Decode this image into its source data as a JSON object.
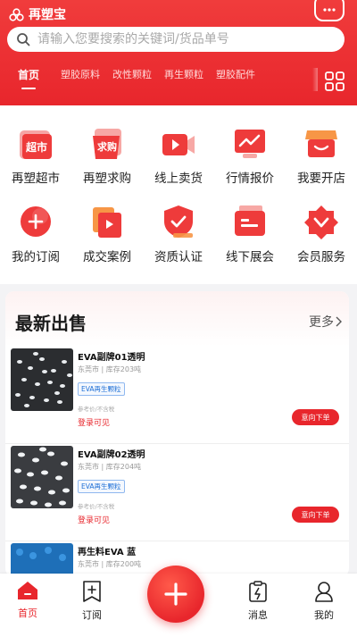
{
  "app": {
    "name": "再塑宝"
  },
  "search": {
    "placeholder": "请输入您要搜索的关键词/货品单号"
  },
  "tabs": [
    {
      "label": "首页",
      "active": true
    },
    {
      "label": "塑胶原料"
    },
    {
      "label": "改性颗粒"
    },
    {
      "label": "再生颗粒"
    },
    {
      "label": "塑胶配件"
    }
  ],
  "categories": [
    {
      "label": "再塑超市",
      "icon": "supermarket-icon",
      "badge": "超市"
    },
    {
      "label": "再塑求购",
      "icon": "purchase-icon",
      "badge": "求购"
    },
    {
      "label": "线上卖货",
      "icon": "video-icon"
    },
    {
      "label": "行情报价",
      "icon": "trend-icon"
    },
    {
      "label": "我要开店",
      "icon": "shop-icon"
    },
    {
      "label": "我的订阅",
      "icon": "subscribe-icon"
    },
    {
      "label": "成交案例",
      "icon": "case-icon"
    },
    {
      "label": "资质认证",
      "icon": "certified-icon"
    },
    {
      "label": "线下展会",
      "icon": "exhibition-icon"
    },
    {
      "label": "会员服务",
      "icon": "vip-icon"
    }
  ],
  "latest": {
    "title": "最新出售",
    "more": "更多",
    "items": [
      {
        "name": "EVA副牌01透明",
        "meta": "东莞市 | 库存203吨",
        "tag": "EVA再生颗粒",
        "small": "参考价/不含税",
        "price": "登录可见",
        "button": "意向下单"
      },
      {
        "name": "EVA副牌02透明",
        "meta": "东莞市 | 库存204吨",
        "tag": "EVA再生颗粒",
        "small": "参考价/不含税",
        "price": "登录可见",
        "button": "意向下单"
      },
      {
        "name": "再生料EVA 蓝",
        "meta": "东莞市 | 库存200吨"
      }
    ]
  },
  "tabbar": [
    {
      "label": "首页",
      "icon": "home-icon",
      "active": true
    },
    {
      "label": "订阅",
      "icon": "subscribe-tab-icon"
    },
    {
      "label": "",
      "icon": "plus-icon"
    },
    {
      "label": "消息",
      "icon": "message-icon"
    },
    {
      "label": "我的",
      "icon": "profile-icon"
    }
  ],
  "colors": {
    "brand": "#e8262c",
    "tag_blue": "#1e6fd6"
  }
}
